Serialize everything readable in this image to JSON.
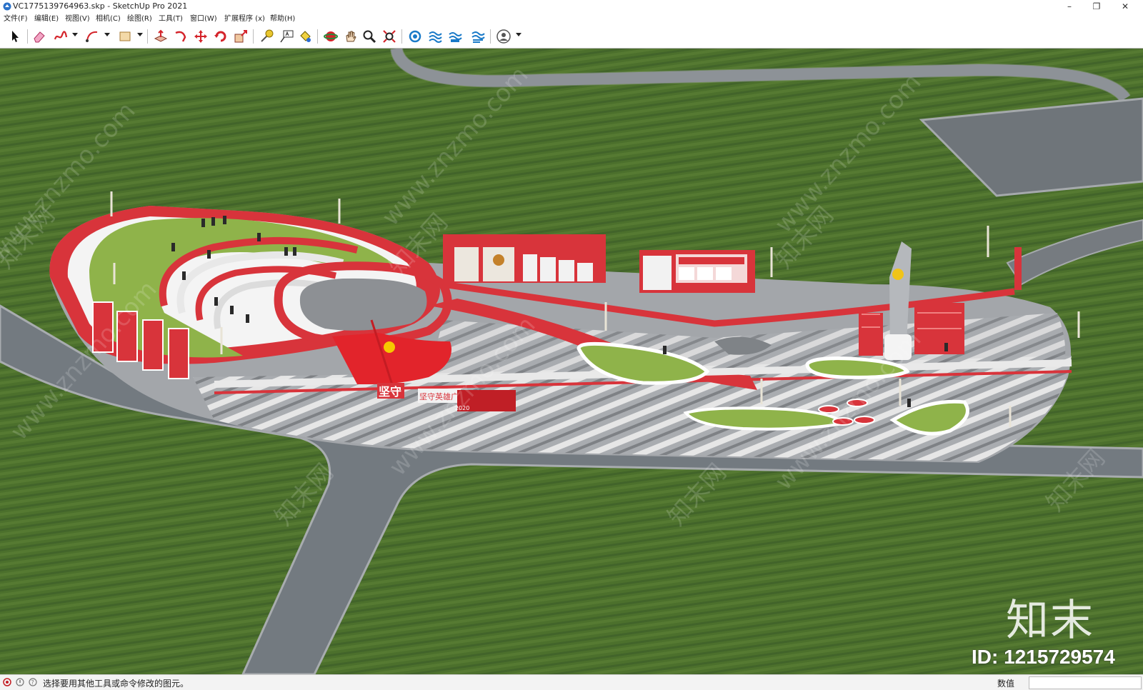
{
  "window": {
    "title": "VC1775139764963.skp - SketchUp Pro 2021",
    "minimize": "–",
    "maximize": "❐",
    "close": "✕"
  },
  "menu": [
    {
      "label": "文件(F)"
    },
    {
      "label": "编辑(E)"
    },
    {
      "label": "视图(V)"
    },
    {
      "label": "相机(C)"
    },
    {
      "label": "绘图(R)"
    },
    {
      "label": "工具(T)"
    },
    {
      "label": "窗口(W)"
    },
    {
      "label": "扩展程序 (x)"
    },
    {
      "label": "帮助(H)"
    }
  ],
  "toolbar": {
    "tools": [
      {
        "name": "select-icon"
      },
      {
        "name": "eraser-icon"
      },
      {
        "name": "freehand-icon"
      },
      {
        "name": "arc-icon"
      },
      {
        "name": "rectangle-icon"
      },
      {
        "name": "push-pull-icon"
      },
      {
        "name": "follow-me-icon"
      },
      {
        "name": "move-icon"
      },
      {
        "name": "rotate-icon"
      },
      {
        "name": "scale-icon"
      },
      {
        "name": "tape-measure-icon"
      },
      {
        "name": "text-icon"
      },
      {
        "name": "paint-bucket-icon"
      },
      {
        "name": "orbit-icon"
      },
      {
        "name": "pan-icon"
      },
      {
        "name": "zoom-icon"
      },
      {
        "name": "zoom-extents-icon"
      },
      {
        "name": "warehouse-icon"
      },
      {
        "name": "extension-warehouse-icon"
      },
      {
        "name": "layout-icon"
      },
      {
        "name": "extension-manager-icon"
      },
      {
        "name": "account-icon"
      }
    ]
  },
  "scene": {
    "flag_label": "坚守",
    "sign_label": "坚守英雄广场",
    "sign_year": "2020",
    "watermark_text": "www.znzmo.com",
    "watermark_brand": "知末网"
  },
  "watermark": {
    "logo": "知末",
    "id": "ID: 1215729574"
  },
  "statusbar": {
    "hint": "选择要用其他工具或命令修改的图元。",
    "vcb_label": "数值",
    "vcb_value": ""
  },
  "colors": {
    "grass": "#4a6d2a",
    "road": "#767b80",
    "plaza_red": "#d8343b",
    "plaza_gray": "#9ea1a5",
    "lawn": "#8fb34a"
  }
}
